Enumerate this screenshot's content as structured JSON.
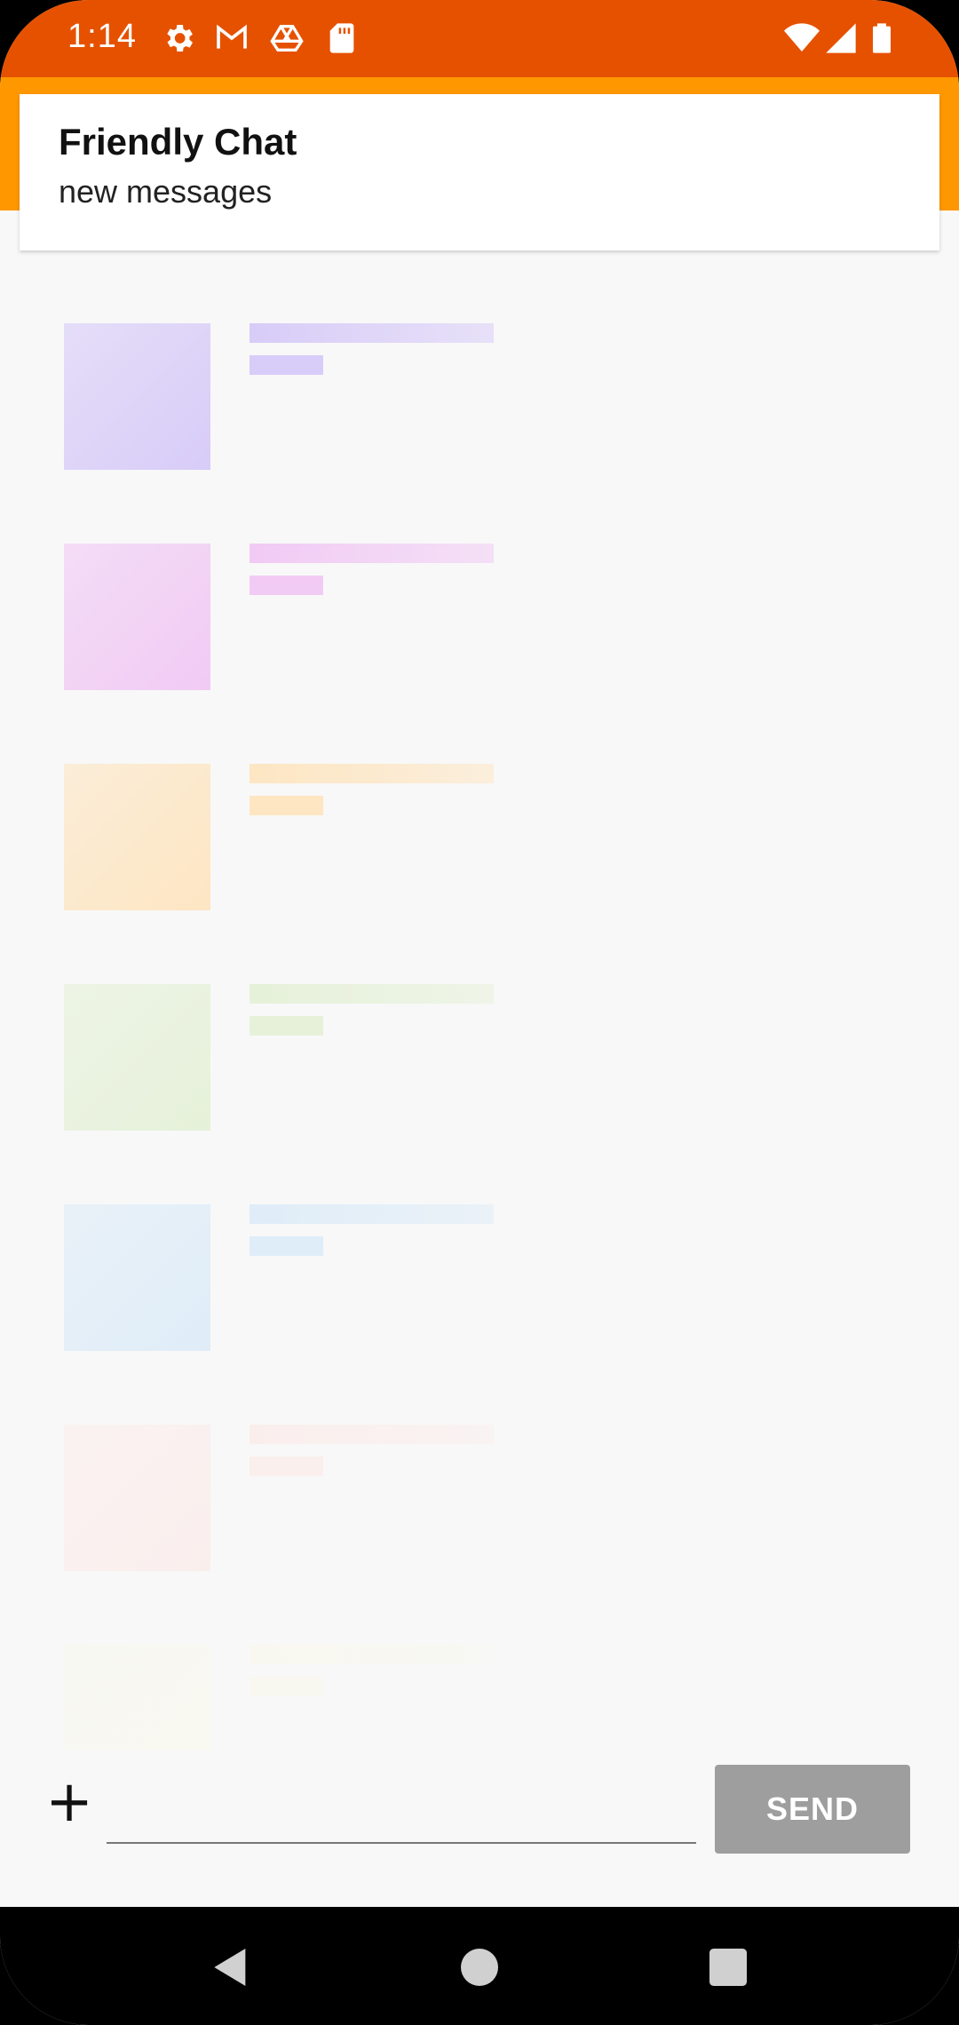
{
  "status_bar": {
    "time": "1:14",
    "icons_left": [
      "gear-icon",
      "gmail-icon",
      "drive-icon",
      "sd-card-icon"
    ],
    "icons_right": [
      "wifi-icon",
      "cell-signal-icon",
      "battery-icon"
    ],
    "color": "#e65100"
  },
  "app_bar": {
    "color": "#ff9800"
  },
  "notification": {
    "title": "Friendly Chat",
    "text": "new messages"
  },
  "placeholders": [
    {
      "color": "#d8ccf8"
    },
    {
      "color": "#f0c4f4"
    },
    {
      "color": "#ffe0b2"
    },
    {
      "color": "#dcedc8"
    },
    {
      "color": "#c8e2f8"
    },
    {
      "color": "#fde0dc"
    },
    {
      "color": "#fbf8dc"
    }
  ],
  "composer": {
    "add_label": "+",
    "input_placeholder": "",
    "send_label": "SEND"
  },
  "nav": {
    "back": "back-icon",
    "home": "home-icon",
    "recents": "recents-icon"
  }
}
